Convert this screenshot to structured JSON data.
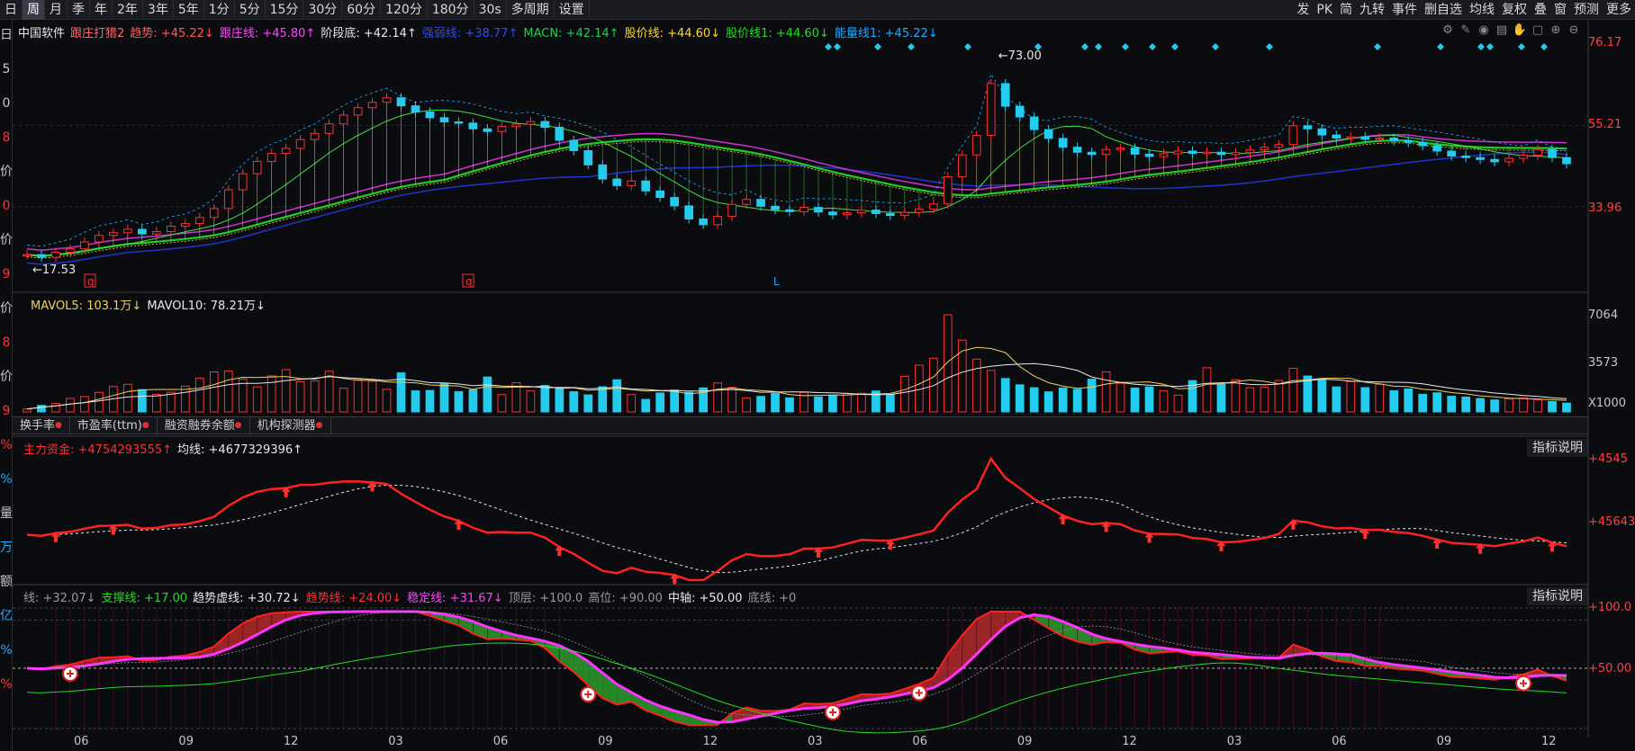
{
  "toolbar": {
    "periods": [
      "日",
      "周",
      "月",
      "季",
      "年",
      "2年",
      "3年",
      "5年",
      "1分",
      "5分",
      "15分",
      "30分",
      "60分",
      "120分",
      "180分",
      "30s"
    ],
    "active": "周",
    "extra": [
      "多周期",
      "设置"
    ],
    "right": [
      "发",
      "PK",
      "简",
      "九转",
      "事件",
      "删自选",
      "均线",
      "复权",
      "叠",
      "窗",
      "预测",
      "更多"
    ]
  },
  "left_strip": [
    "日",
    "5",
    "0",
    "8",
    "价",
    "0",
    "价",
    "9",
    "价",
    "8",
    "价",
    "9",
    "%",
    "%",
    "量",
    "万",
    "额",
    "亿",
    "%",
    "%"
  ],
  "main_panel": {
    "legend": [
      {
        "text": "中国软件",
        "color": "#e8e8e8"
      },
      {
        "text": "跟庄打猎2",
        "color": "#ff6a6a"
      },
      {
        "text": "趋势: +45.22↓",
        "color": "#ff5a5a"
      },
      {
        "text": "跟庄线: +45.80↑",
        "color": "#ff44ff"
      },
      {
        "text": "阶段底: +42.14↑",
        "color": "#e8e8e8"
      },
      {
        "text": "强弱线: +38.77↑",
        "color": "#2b4bff"
      },
      {
        "text": "MACN: +42.14↑",
        "color": "#22cc55"
      },
      {
        "text": "股价线: +44.60↓",
        "color": "#ffd82a"
      },
      {
        "text": "股价线1: +44.60↓",
        "color": "#22dd22"
      },
      {
        "text": "能量线1: +45.22↓",
        "color": "#22aaff"
      }
    ],
    "axis_labels": [
      "76.17",
      "55.21",
      "33.96"
    ],
    "annotations": {
      "high": "73.00",
      "low": "17.53",
      "marks": [
        "q",
        "q",
        "L"
      ]
    }
  },
  "volume_panel": {
    "legend": [
      {
        "text": "MAVOL5: 103.1万↓",
        "color": "#f0d060"
      },
      {
        "text": "MAVOL10: 78.21万↓",
        "color": "#e8e8e8"
      }
    ],
    "axis_labels": [
      "7064",
      "3573",
      "X1000"
    ]
  },
  "tabs": [
    "换手率",
    "市盈率(ttm)",
    "融资融券余额",
    "机构探测器"
  ],
  "flow_panel": {
    "legend": [
      {
        "text": "主力资金: +4754293555↑",
        "color": "#ff3030"
      },
      {
        "text": "均线: +4677329396↑",
        "color": "#e8e8e8"
      }
    ],
    "explain": "指标说明",
    "axis_labels": [
      "+4545",
      "+45643"
    ]
  },
  "osc_panel": {
    "legend": [
      {
        "text": "线: +32.07↓",
        "color": "#9a9aa0"
      },
      {
        "text": "支撑线: +17.00",
        "color": "#22dd22"
      },
      {
        "text": "趋势虚线: +30.72↓",
        "color": "#e8e8e8"
      },
      {
        "text": "趋势线: +24.00↓",
        "color": "#ff3030"
      },
      {
        "text": "稳定线: +31.67↓",
        "color": "#ff44ff"
      },
      {
        "text": "顶层: +100.0",
        "color": "#9a9aa0"
      },
      {
        "text": "高位: +90.00",
        "color": "#9a9aa0"
      },
      {
        "text": "中轴: +50.00",
        "color": "#e8e8e8"
      },
      {
        "text": "底线: +0",
        "color": "#9a9aa0"
      }
    ],
    "explain": "指标说明",
    "axis_labels": [
      "+100.0",
      "+50.00"
    ]
  },
  "x_axis_labels": [
    "06",
    "09",
    "12",
    "03",
    "06",
    "09",
    "12",
    "03",
    "06",
    "09",
    "12",
    "03",
    "06",
    "09",
    "12"
  ],
  "chart_data": {
    "type": "candlestick",
    "title": "中国软件",
    "y_range": [
      17.53,
      76.17
    ],
    "x_labels": [
      "06",
      "09",
      "12",
      "03",
      "06",
      "09",
      "12",
      "03",
      "06",
      "09",
      "12",
      "03",
      "06",
      "09",
      "12"
    ],
    "close": [
      21.5,
      20.8,
      22.1,
      23.0,
      24.8,
      26.5,
      27.2,
      28.1,
      26.9,
      27.5,
      28.9,
      29.6,
      31.2,
      33.5,
      38.4,
      42.6,
      45.8,
      47.9,
      49.2,
      51.5,
      53.1,
      55.6,
      57.9,
      59.8,
      61.2,
      62.4,
      60.3,
      58.7,
      57.2,
      56.1,
      55.8,
      54.3,
      53.6,
      54.9,
      55.5,
      56.2,
      54.7,
      51.3,
      48.6,
      44.9,
      41.2,
      39.5,
      40.7,
      38.1,
      36.4,
      34.2,
      30.8,
      29.3,
      31.5,
      34.6,
      35.9,
      34.1,
      33.2,
      32.7,
      33.8,
      32.6,
      31.9,
      32.4,
      33.1,
      32.2,
      31.7,
      32.5,
      33.4,
      34.7,
      41.8,
      47.5,
      52.6,
      66.1,
      60.2,
      57.4,
      54.1,
      51.8,
      49.5,
      48.2,
      47.6,
      48.9,
      49.3,
      47.7,
      47.1,
      47.8,
      48.5,
      47.9,
      48.2,
      47.6,
      48.1,
      48.8,
      49.5,
      50.2,
      55.1,
      54.3,
      52.7,
      51.9,
      52.2,
      51.6,
      51.9,
      51.2,
      50.8,
      49.9,
      48.5,
      47.2,
      46.8,
      46.3,
      45.7,
      46.6,
      47.4,
      48.9,
      46.8,
      45.2
    ],
    "volume_k": [
      210,
      480,
      620,
      980,
      1120,
      1420,
      1850,
      2010,
      1620,
      1280,
      1430,
      1870,
      2450,
      2910,
      2980,
      2380,
      1820,
      2620,
      3080,
      2190,
      2250,
      2960,
      1720,
      2350,
      2230,
      1650,
      2840,
      1530,
      1560,
      2050,
      1480,
      1610,
      2540,
      1260,
      2130,
      1530,
      1920,
      1710,
      1470,
      1240,
      1830,
      2340,
      1260,
      910,
      1380,
      1590,
      1430,
      1750,
      2110,
      1780,
      1010,
      1130,
      1350,
      1020,
      1420,
      1090,
      1230,
      1340,
      1360,
      1520,
      1260,
      2590,
      3400,
      3910,
      7064,
      5220,
      3840,
      3020,
      2430,
      1970,
      1760,
      1460,
      1740,
      1640,
      2380,
      2910,
      2080,
      1740,
      1820,
      1530,
      1220,
      2280,
      3210,
      2010,
      2340,
      1760,
      1790,
      2290,
      3170,
      2610,
      2380,
      1820,
      2210,
      1770,
      2010,
      1540,
      1670,
      1280,
      1390,
      1140,
      1080,
      980,
      870,
      940,
      1010,
      880,
      760,
      640
    ]
  }
}
